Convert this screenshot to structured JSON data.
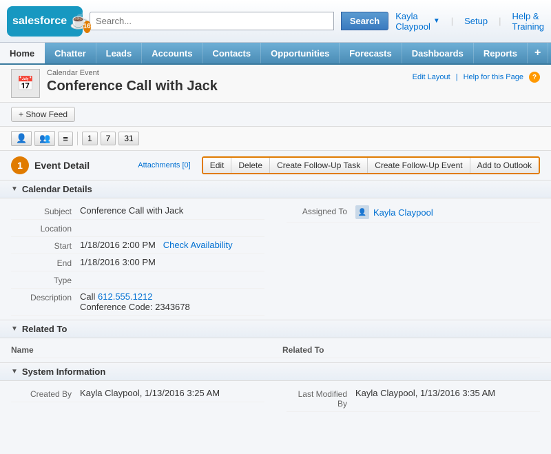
{
  "header": {
    "logo_text": "salesforce",
    "search_placeholder": "Search...",
    "search_btn": "Search",
    "user_name": "Kayla Claypool",
    "setup_link": "Setup",
    "help_link": "Help & Training"
  },
  "nav": {
    "items": [
      {
        "label": "Home",
        "active": true
      },
      {
        "label": "Chatter",
        "active": false
      },
      {
        "label": "Leads",
        "active": false
      },
      {
        "label": "Accounts",
        "active": false
      },
      {
        "label": "Contacts",
        "active": false
      },
      {
        "label": "Opportunities",
        "active": false
      },
      {
        "label": "Forecasts",
        "active": false
      },
      {
        "label": "Dashboards",
        "active": false
      },
      {
        "label": "Reports",
        "active": false
      },
      {
        "label": "+",
        "active": false
      }
    ]
  },
  "page": {
    "breadcrumb": "Calendar Event",
    "title": "Conference Call with Jack",
    "edit_layout": "Edit Layout",
    "help_page": "Help for this Page",
    "show_feed_btn": "Show Feed"
  },
  "event_detail": {
    "title": "Event Detail",
    "attachments": "Attachments [0]",
    "step_num": "1",
    "btn_edit": "Edit",
    "btn_delete": "Delete",
    "btn_follow_task": "Create Follow-Up Task",
    "btn_follow_event": "Create Follow-Up Event",
    "btn_outlook": "Add to Outlook"
  },
  "calendar_details": {
    "section_label": "Calendar Details",
    "subject_label": "Subject",
    "subject_value": "Conference Call with Jack",
    "location_label": "Location",
    "location_value": "",
    "start_label": "Start",
    "start_value": "1/18/2016 2:00 PM",
    "check_availability": "Check Availability",
    "end_label": "End",
    "end_value": "1/18/2016 3:00 PM",
    "type_label": "Type",
    "type_value": "",
    "description_label": "Description",
    "description_phone": "612.555.1212",
    "description_text": "\nConference Code: 2343678",
    "assigned_label": "Assigned To",
    "assigned_name": "Kayla Claypool"
  },
  "related_to": {
    "section_label": "Related To",
    "name_label": "Name",
    "related_label": "Related To"
  },
  "system_info": {
    "section_label": "System Information",
    "created_by_label": "Created By",
    "created_by_value": "Kayla Claypool, 1/13/2016 3:25 AM",
    "modified_by_label": "Last Modified By",
    "modified_by_value": "Kayla Claypool, 1/13/2016 3:35 AM"
  }
}
